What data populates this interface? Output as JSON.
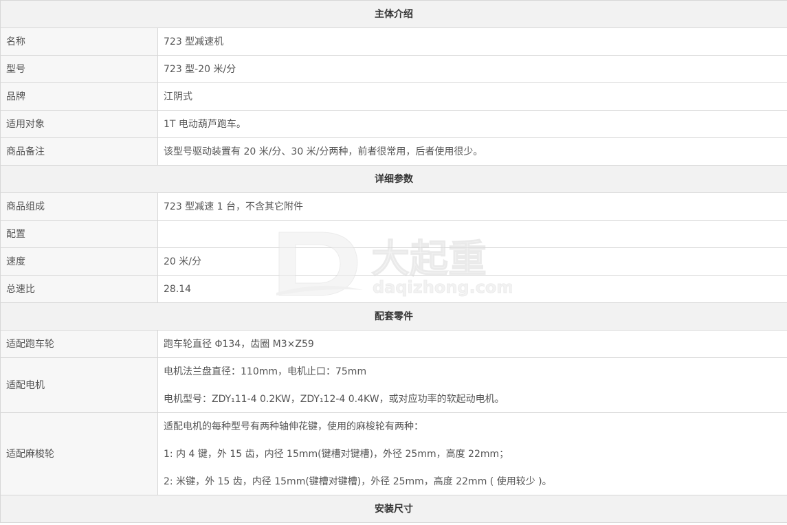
{
  "sections": {
    "intro": "主体介绍",
    "details": "详细参数",
    "parts": "配套零件",
    "install": "安装尺寸"
  },
  "intro_rows": [
    {
      "label": "名称",
      "value": "723 型减速机"
    },
    {
      "label": "型号",
      "value": "723 型-20 米/分"
    },
    {
      "label": "品牌",
      "value": "江阴式"
    },
    {
      "label": "适用对象",
      "value": "1T 电动葫芦跑车。"
    },
    {
      "label": "商品备注",
      "value": "该型号驱动装置有 20 米/分、30 米/分两种，前者很常用，后者使用很少。"
    }
  ],
  "detail_rows": [
    {
      "label": "商品组成",
      "value": "723 型减速 1 台，不含其它附件"
    },
    {
      "label": "配置",
      "value": ""
    },
    {
      "label": "速度",
      "value": "20  米/分"
    },
    {
      "label": "总速比",
      "value": "28.14"
    }
  ],
  "parts_rows": {
    "wheel": {
      "label": "适配跑车轮",
      "value": "跑车轮直径 Φ134，齿圈 M3×Z59"
    },
    "motor": {
      "label": "适配电机",
      "lines": [
        "电机法兰盘直径：110mm，电机止口：75mm",
        "电机型号：ZDY₁11-4    0.2KW，ZDY₁12-4    0.4KW，或对应功率的软起动电机。"
      ]
    },
    "spline": {
      "label": "适配麻梭轮",
      "lines": [
        "适配电机的每种型号有两种轴伸花键，使用的麻梭轮有两种：",
        "1:  内 4 键，外 15 齿，内径 15mm(键槽对键槽)，外径 25mm，高度 22mm；",
        "2:  米键，外 15 齿，内径 15mm(键槽对键槽)，外径 25mm，高度 22mm ( 使用较少 )。"
      ]
    }
  },
  "watermark": {
    "logo_text": "大起重",
    "url_text": "daqizhong.com",
    "color": "#e6e6e6"
  }
}
